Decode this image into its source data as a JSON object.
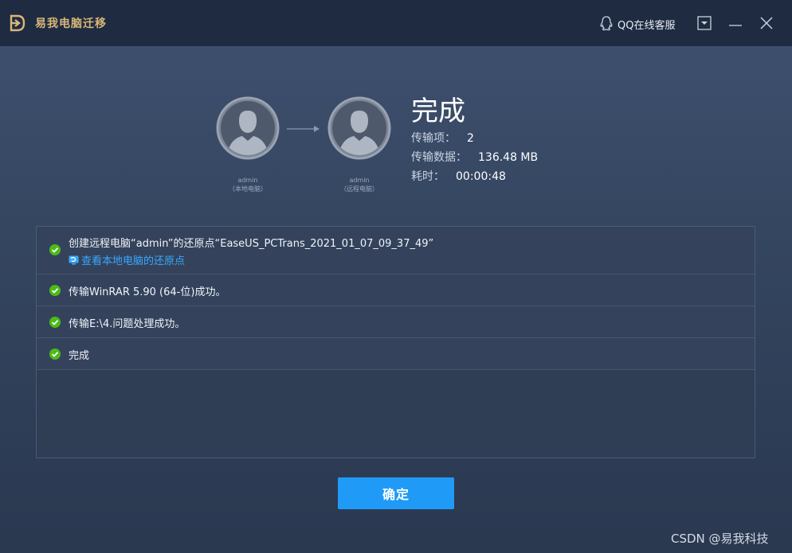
{
  "app": {
    "title": "易我电脑迁移"
  },
  "titlebar": {
    "support_label": "QQ在线客服"
  },
  "transfer": {
    "source": {
      "name": "admin",
      "sub": "（本地电脑）"
    },
    "target": {
      "name": "admin",
      "sub": "（远程电脑）"
    }
  },
  "summary": {
    "title": "完成",
    "items_label": "传输项：",
    "items_value": "2",
    "data_label": "传输数据：",
    "data_value": "136.48 MB",
    "time_label": "耗时：",
    "time_value": "00:00:48"
  },
  "log": [
    {
      "text": "创建远程电脑“admin”的还原点“EaseUS_PCTrans_2021_01_07_09_37_49”",
      "link": "查看本地电脑的还原点"
    },
    {
      "text": "传输WinRAR 5.90 (64-位)成功。"
    },
    {
      "text": "传输E:\\4.问题处理成功。"
    },
    {
      "text": "完成"
    }
  ],
  "buttons": {
    "ok_label": "确定"
  },
  "watermark": "CSDN @易我科技",
  "colors": {
    "accent": "#1f9bf7",
    "success": "#4cbb17",
    "link": "#38a8ff",
    "brand": "#d7b77a"
  }
}
